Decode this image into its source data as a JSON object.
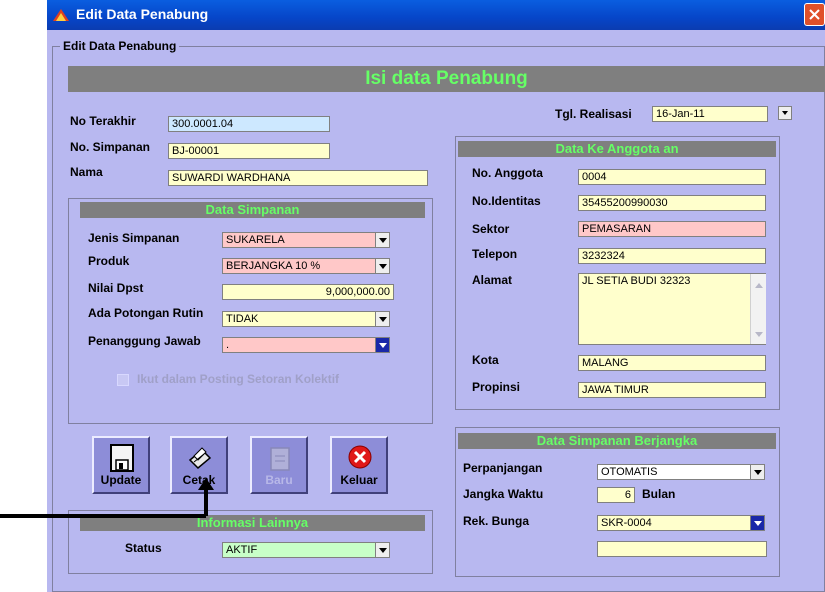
{
  "window": {
    "title": "Edit Data Penabung"
  },
  "group": {
    "title": "Edit Data Penabung"
  },
  "main_header": "Isi data Penabung",
  "top": {
    "no_terakhir_label": "No Terakhir",
    "no_terakhir_value": "300.0001.04",
    "no_simpanan_label": "No. Simpanan",
    "no_simpanan_value": "BJ-00001",
    "nama_label": "Nama",
    "nama_value": "SUWARDI WARDHANA",
    "tgl_label": "Tgl. Realisasi",
    "tgl_value": "16-Jan-11"
  },
  "simpanan": {
    "header": "Data Simpanan",
    "jenis_label": "Jenis Simpanan",
    "jenis_value": "SUKARELA",
    "produk_label": "Produk",
    "produk_value": "BERJANGKA 10 %",
    "nilai_label": "Nilai Dpst",
    "nilai_value": "9,000,000.00",
    "potongan_label": "Ada Potongan Rutin",
    "potongan_value": "TIDAK",
    "penanggung_label": "Penanggung Jawab",
    "penanggung_value": ".",
    "posting_label": "Ikut dalam Posting Setoran Kolektif"
  },
  "buttons": {
    "update": "Update",
    "cetak": "Cetak",
    "baru": "Baru",
    "keluar": "Keluar"
  },
  "info": {
    "header": "Informasi Lainnya",
    "status_label": "Status",
    "status_value": "AKTIF"
  },
  "anggota": {
    "header": "Data Ke Anggota an",
    "no_anggota_label": "No. Anggota",
    "no_anggota_value": "0004",
    "identitas_label": "No.Identitas",
    "identitas_value": "35455200990030",
    "sektor_label": "Sektor",
    "sektor_value": "PEMASARAN",
    "telepon_label": "Telepon",
    "telepon_value": "3232324",
    "alamat_label": "Alamat",
    "alamat_value": "JL SETIA BUDI 32323",
    "kota_label": "Kota",
    "kota_value": "MALANG",
    "propinsi_label": "Propinsi",
    "propinsi_value": "JAWA TIMUR"
  },
  "berjangka": {
    "header": "Data Simpanan Berjangka",
    "perpanjangan_label": "Perpanjangan",
    "perpanjangan_value": "OTOMATIS",
    "jangka_label": "Jangka Waktu",
    "jangka_value": "6",
    "jangka_unit": "Bulan",
    "rek_label": "Rek. Bunga",
    "rek_value": "SKR-0004",
    "rek_value2": ""
  },
  "colors": {
    "header_bg": "#7f7f7f",
    "header_text": "#66ff66",
    "window_bg": "#b8b8f0"
  }
}
